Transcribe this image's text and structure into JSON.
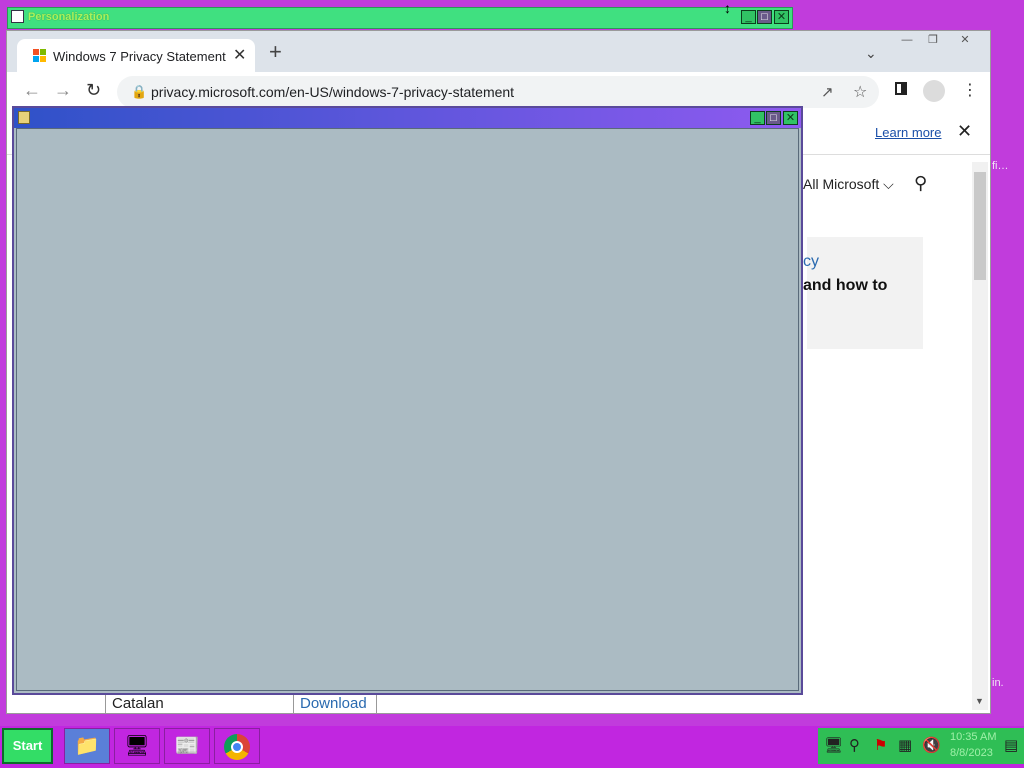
{
  "desktop": {
    "peek_top": "fi…",
    "peek_bottom": "in."
  },
  "personalization_window": {
    "title": "Personalization",
    "buttons": {
      "minimize": "_",
      "maximize": "□",
      "close": "✕"
    }
  },
  "browser": {
    "tab": {
      "title": "Windows 7 Privacy Statement",
      "close": "✕"
    },
    "new_tab": "+",
    "tab_search": "⌄",
    "window_controls": {
      "minimize": "—",
      "restore": "❐",
      "close": "✕"
    },
    "nav": {
      "back": "←",
      "forward": "→",
      "reload": "↻"
    },
    "url": "privacy.microsoft.com/en-US/windows-7-privacy-statement",
    "page": {
      "learn_more": "Learn more",
      "banner_close": "✕",
      "all_microsoft": "All Microsoft ⌵",
      "card_link": "cy",
      "card_text": "and how to",
      "table_cell_language": "Catalan",
      "table_cell_download": "Download"
    }
  },
  "foreground_window": {
    "title": "",
    "buttons": {
      "minimize": "_",
      "maximize": "□",
      "close": "✕"
    }
  },
  "taskbar": {
    "start_label": "Start",
    "clock_time": "10:35 AM",
    "clock_date": "8/8/2023"
  },
  "colors": {
    "desktop": "#c13cdc",
    "taskbar": "#c126e0",
    "start_button": "#33dd66",
    "tray": "#2fbe55",
    "foreground_window": "#abbbc3"
  }
}
